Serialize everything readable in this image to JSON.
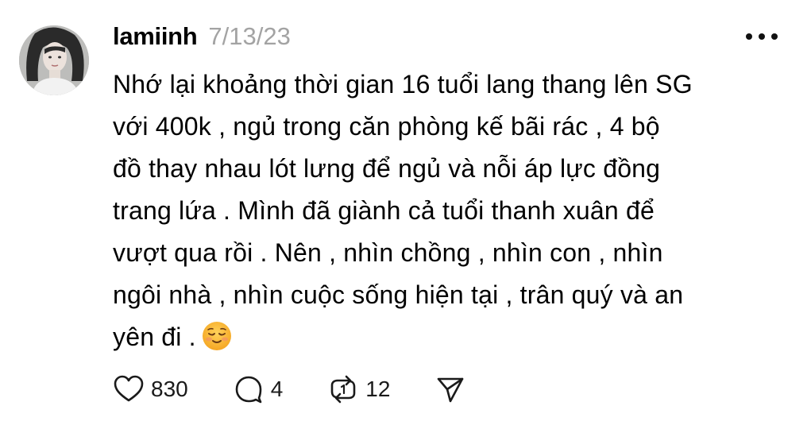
{
  "post": {
    "username": "lamiinh",
    "timestamp": "7/13/23",
    "content_lines": [
      "Nhớ lại khoảng thời gian 16 tuổi lang thang lên SG",
      "với 400k , ngủ trong căn phòng kế bãi rác , 4 bộ",
      "đồ thay nhau lót lưng để ngủ và nỗi áp lực đồng",
      "trang lứa . Mình đã giành cả tuổi thanh xuân để",
      "vượt qua rồi . Nên , nhìn chồng , nhìn con , nhìn",
      "ngôi nhà , nhìn cuộc sống hiện tại , trân quý và an",
      "yên đi ."
    ],
    "emoji": "smiling-face-emoji"
  },
  "actions": {
    "likes": "830",
    "replies": "4",
    "reposts": "12"
  },
  "icons": {
    "like": "heart-icon",
    "reply": "speech-bubble-icon",
    "repost": "repost-icon",
    "share": "send-icon",
    "more": "more-options-icon"
  },
  "colors": {
    "text": "#000000",
    "muted": "#a3a3a3",
    "emoji": "#f8b93a"
  }
}
